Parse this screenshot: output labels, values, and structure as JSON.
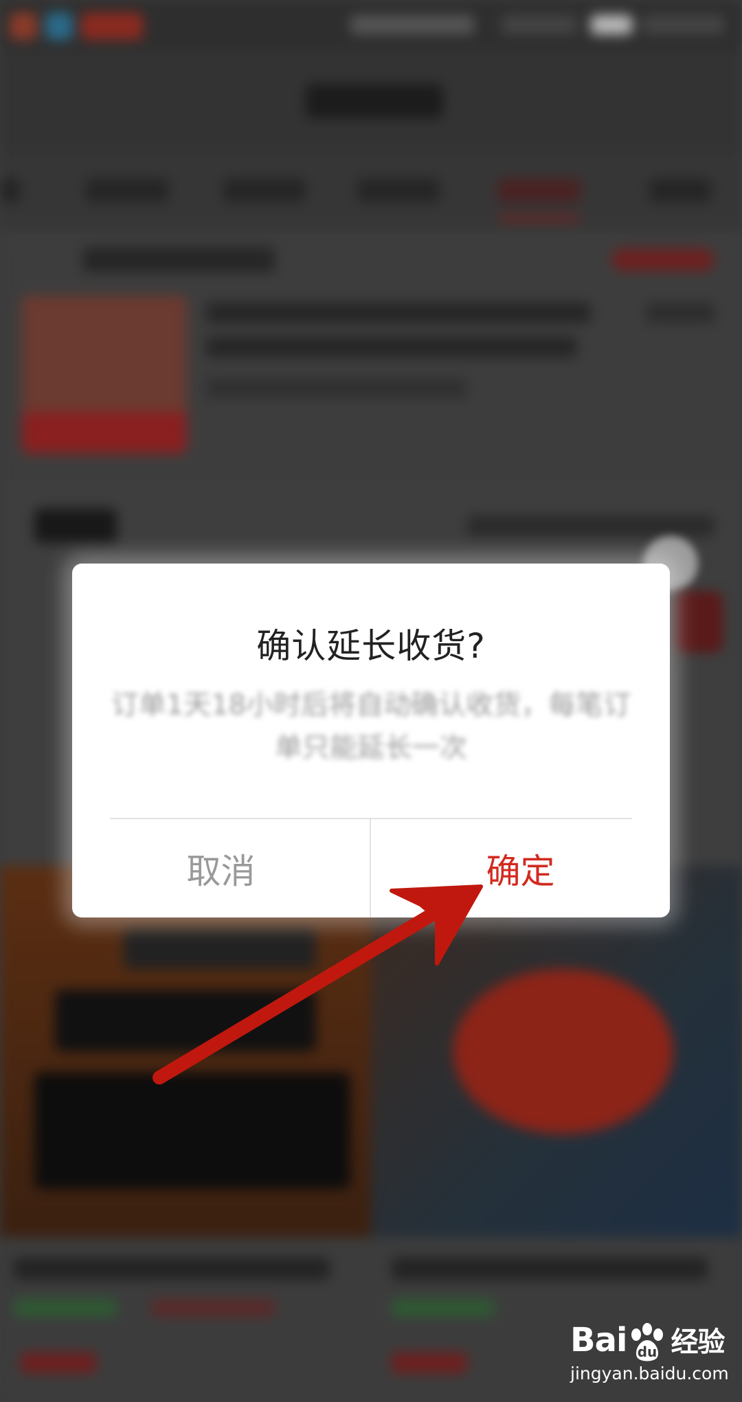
{
  "dialog": {
    "title": "确认延长收货?",
    "message": "订单1天18小时后将自动确认收货，每笔订单只能延长一次",
    "cancel_label": "取消",
    "confirm_label": "确定"
  },
  "watermark": {
    "brand_left": "Bai",
    "brand_right": "du",
    "brand_cn": "经验",
    "url": "jingyan.baidu.com"
  },
  "colors": {
    "confirm": "#d22a20",
    "cancel": "#999999",
    "arrow": "#c0180e"
  },
  "icons": {
    "annotation": "red-pointer-arrow",
    "paw": "baidu-paw-icon"
  }
}
